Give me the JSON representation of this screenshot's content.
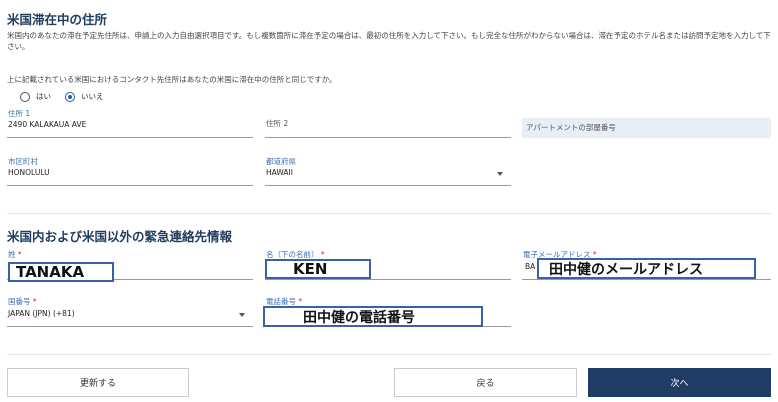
{
  "address_section": {
    "title": "米国滞在中の住所",
    "description": "米国内のあなたの滞在予定先住所は、申請上の入力自由選択項目です。もし複数箇所に滞在予定の場合は、最初の住所を入力して下さい。もし完全な住所がわからない場合は、滞在予定のホテル名または訪問予定地を入力して下さい。",
    "same_address_question": "上に記載されている米国におけるコンタクト先住所はあなたの米国に滞在中の住所と同じですか。",
    "radio_yes": "はい",
    "radio_no": "いいえ",
    "address1_label": "住所 1",
    "address1_value": "2490 KALAKAUA AVE",
    "address2_placeholder": "住所 2",
    "apartment_placeholder": "アパートメントの部屋番号",
    "city_label": "市区町村",
    "city_value": "HONOLULU",
    "state_label": "都道府県",
    "state_value": "HAWAII"
  },
  "emergency_section": {
    "title": "米国内および米国以外の緊急連絡先情報",
    "last_name_label": "姓",
    "last_name_value": "TANAKA",
    "first_name_label": "名（下の名前）",
    "first_name_value": "KEN",
    "email_label": "電子メールアドレス",
    "email_prefix": "BA",
    "email_value": "田中健のメールアドレス",
    "country_code_label": "国番号",
    "country_code_value": "JAPAN (JPN) (+81)",
    "phone_label": "電話番号",
    "phone_value": "田中健の電話番号",
    "required_mark": "*"
  },
  "buttons": {
    "update": "更新する",
    "back": "戻る",
    "next": "次へ"
  },
  "colors": {
    "accent": "#1f3c64",
    "label_blue": "#3a6fb0",
    "required_red": "#c0392b"
  }
}
